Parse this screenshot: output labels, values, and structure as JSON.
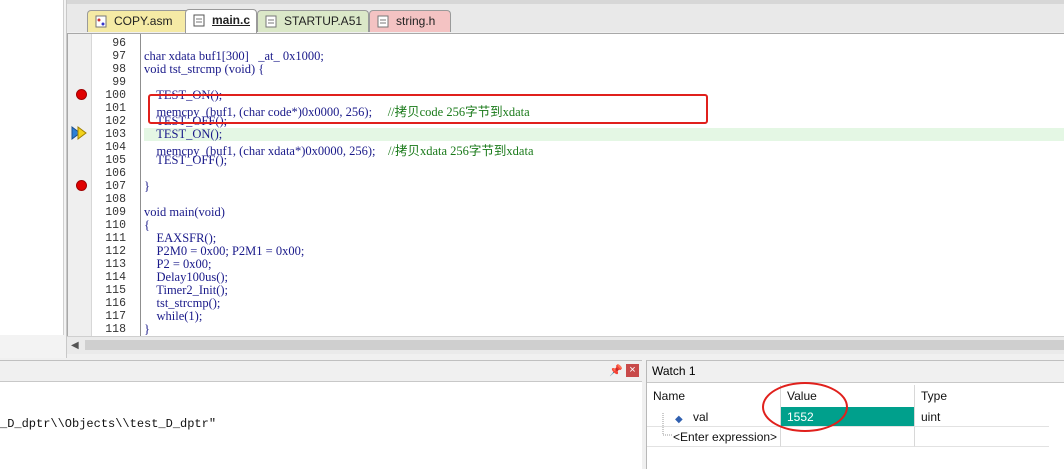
{
  "tabs": [
    {
      "label": "COPY.asm",
      "color": "#f5eaa5",
      "active": false
    },
    {
      "label": "main.c",
      "color": "#f7f0c6",
      "active": true
    },
    {
      "label": "STARTUP.A51",
      "color": "#dbe8c8",
      "active": false
    },
    {
      "label": "string.h",
      "color": "#f4c3c3",
      "active": false
    }
  ],
  "editor": {
    "lines": [
      {
        "no": "96",
        "code": ""
      },
      {
        "no": "97",
        "code": "char xdata buf1[300]   _at_ 0x1000;"
      },
      {
        "no": "98",
        "code": "void tst_strcmp (void) {"
      },
      {
        "no": "99",
        "code": ""
      },
      {
        "no": "100",
        "code": "    TEST_ON();"
      },
      {
        "no": "101",
        "code": "    memcpy  (buf1, (char code*)0x0000, 256);     //拷贝code 256字节到xdata"
      },
      {
        "no": "102",
        "code": "    TEST_OFF();"
      },
      {
        "no": "103",
        "code": "    TEST_ON();"
      },
      {
        "no": "104",
        "code": "    memcpy  (buf1, (char xdata*)0x0000, 256);    //拷贝xdata 256字节到xdata"
      },
      {
        "no": "105",
        "code": "    TEST_OFF();"
      },
      {
        "no": "106",
        "code": ""
      },
      {
        "no": "107",
        "code": "}"
      },
      {
        "no": "108",
        "code": ""
      },
      {
        "no": "109",
        "code": "void main(void)"
      },
      {
        "no": "110",
        "code": "{"
      },
      {
        "no": "111",
        "code": "    EAXSFR();"
      },
      {
        "no": "112",
        "code": "    P2M0 = 0x00; P2M1 = 0x00;"
      },
      {
        "no": "113",
        "code": "    P2 = 0x00;"
      },
      {
        "no": "114",
        "code": "    Delay100us();"
      },
      {
        "no": "115",
        "code": "    Timer2_Init();"
      },
      {
        "no": "116",
        "code": "    tst_strcmp();"
      },
      {
        "no": "117",
        "code": "    while(1);"
      },
      {
        "no": "118",
        "code": "}"
      }
    ]
  },
  "build_output": {
    "text": "_D_dptr\\\\Objects\\\\test_D_dptr\""
  },
  "watch": {
    "title": "Watch 1",
    "columns": [
      "Name",
      "Value",
      "Type"
    ],
    "rows": [
      {
        "name": "val",
        "value": "1552",
        "type": "uint"
      }
    ],
    "enter_expression": "<Enter expression>"
  },
  "panel_icons": {
    "pin": "pin-icon",
    "close": "close-icon"
  }
}
